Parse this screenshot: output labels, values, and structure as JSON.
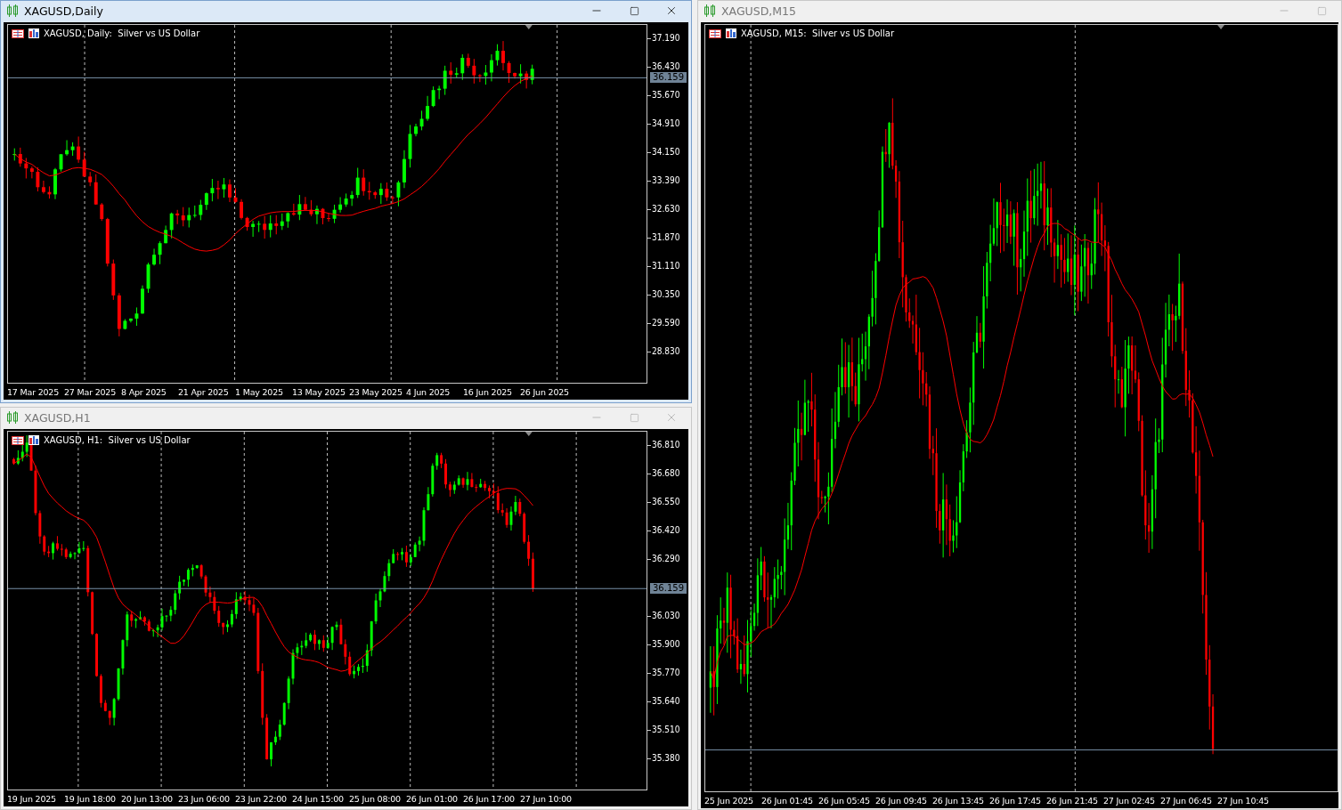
{
  "windows": [
    {
      "title": "XAGUSD,Daily",
      "active": true,
      "buttons": [
        {
          "kind": "minimize"
        },
        {
          "kind": "maximize"
        },
        {
          "kind": "close"
        }
      ],
      "chart": {
        "header": "XAGUSD, Daily:  Silver vs US Dollar",
        "price_ticks": [
          "37.190",
          "36.430",
          "35.670",
          "34.910",
          "34.150",
          "33.390",
          "32.630",
          "31.870",
          "31.110",
          "30.350",
          "29.590",
          "28.830"
        ],
        "current_price": "36.159",
        "time_labels": [
          "17 Mar 2025",
          "27 Mar 2025",
          "8 Apr 2025",
          "21 Apr 2025",
          "1 May 2025",
          "13 May 2025",
          "23 May 2025",
          "4 Jun 2025",
          "16 Jun 2025",
          "26 Jun 2025"
        ]
      }
    },
    {
      "title": "XAGUSD,H1",
      "active": false,
      "buttons": [
        {
          "kind": "minimize"
        },
        {
          "kind": "maximize"
        },
        {
          "kind": "close"
        }
      ],
      "chart": {
        "header": "XAGUSD, H1:  Silver vs US Dollar",
        "price_ticks": [
          "36.810",
          "36.680",
          "36.550",
          "36.420",
          "36.290",
          "36.030",
          "35.900",
          "35.770",
          "35.640",
          "35.510",
          "35.380"
        ],
        "current_price": "36.159",
        "time_labels": [
          "19 Jun 2025",
          "19 Jun 18:00",
          "20 Jun 13:00",
          "23 Jun 06:00",
          "23 Jun 22:00",
          "24 Jun 15:00",
          "25 Jun 08:00",
          "26 Jun 01:00",
          "26 Jun 17:00",
          "27 Jun 10:00"
        ]
      }
    },
    {
      "title": "XAGUSD,M15",
      "active": false,
      "buttons": [
        {
          "kind": "minimize"
        },
        {
          "kind": "maximize"
        }
      ],
      "chart": {
        "header": "XAGUSD, M15:  Silver vs US Dollar",
        "time_labels": [
          "25 Jun 2025",
          "26 Jun 01:45",
          "26 Jun 05:45",
          "26 Jun 09:45",
          "26 Jun 13:45",
          "26 Jun 17:45",
          "26 Jun 21:45",
          "27 Jun 02:45",
          "27 Jun 06:45",
          "27 Jun 10:45"
        ]
      }
    }
  ]
}
